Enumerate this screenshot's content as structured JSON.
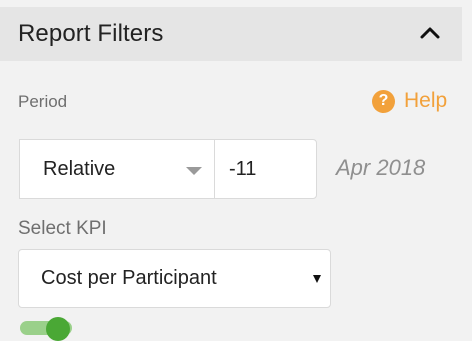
{
  "header": {
    "title": "Report Filters",
    "collapse_icon": "chevron-up-icon"
  },
  "period": {
    "label": "Period",
    "mode_selected": "Relative",
    "offset_value": "-11",
    "date_text": "Apr 2018"
  },
  "help": {
    "icon_text": "?",
    "label": "Help",
    "color": "#f2a13b"
  },
  "kpi": {
    "label": "Select KPI",
    "selected": "Cost per Participant"
  },
  "toggle": {
    "state": "on",
    "color": "#4aa835"
  }
}
